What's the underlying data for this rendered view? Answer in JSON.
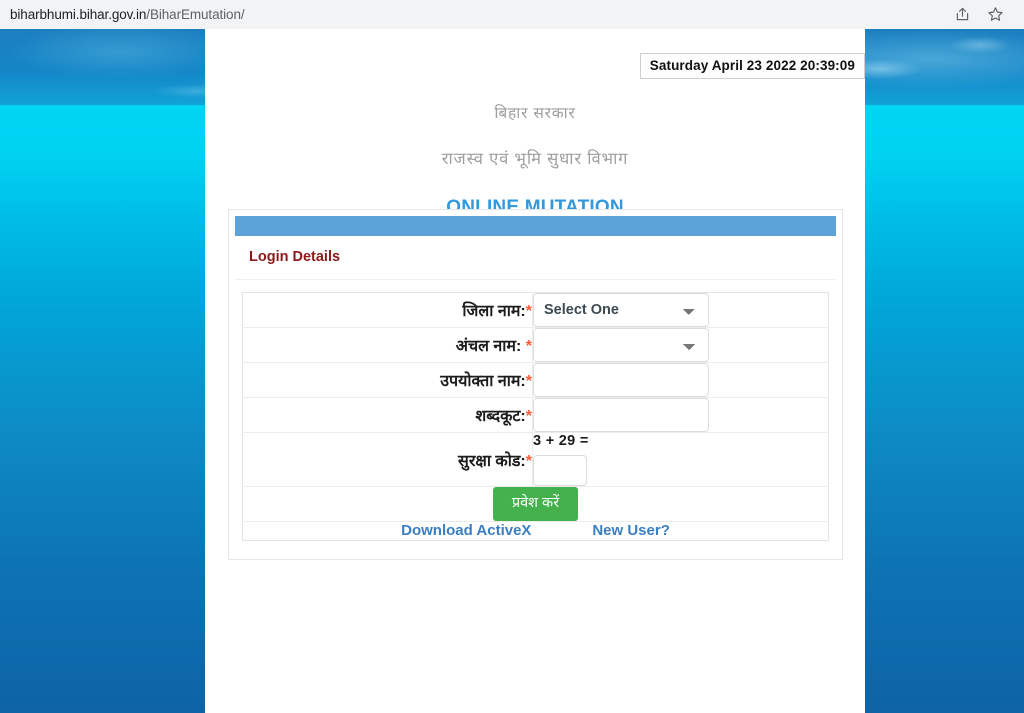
{
  "browser": {
    "url_prefix": "biharbhumi.bihar.gov.in",
    "url_suffix": "/BiharEmutation/",
    "share_icon": "share-icon",
    "bookmark_icon": "star-bookmark-icon"
  },
  "page": {
    "datetime": "Saturday April 23 2022 20:39:09",
    "gov_line1": "बिहार सरकार",
    "gov_line2": "राजस्व एवं भूमि सुधार विभाग",
    "app_title": "ONLINE MUTATION"
  },
  "login_card": {
    "heading": "Login Details",
    "accent_bar_color": "#5ba3d9",
    "heading_color": "#8b1a1a",
    "required_marker_color": "#ff5a36",
    "fields": [
      {
        "label": "जिला नाम:",
        "required": "*",
        "type": "select",
        "value": "Select One",
        "options": [
          "Select One"
        ]
      },
      {
        "label": "अंचल नाम: ",
        "required": "*",
        "type": "select",
        "value": "",
        "options": [
          ""
        ]
      },
      {
        "label": "उपयोक्ता नाम:",
        "required": "*",
        "type": "text",
        "value": "",
        "placeholder": ""
      },
      {
        "label": "शब्दकूट:",
        "required": "*",
        "type": "password",
        "value": "",
        "placeholder": ""
      }
    ],
    "captcha": {
      "label": "सुरक्षा कोड:",
      "required": "*",
      "expression": "3 + 29 =",
      "value": "",
      "placeholder": ""
    },
    "submit_label": "प्रवेश करें",
    "submit_color": "#45b14c",
    "links": [
      {
        "label": "Download ActiveX"
      },
      {
        "label": "New User?"
      }
    ],
    "link_color": "#3a7fc1"
  }
}
